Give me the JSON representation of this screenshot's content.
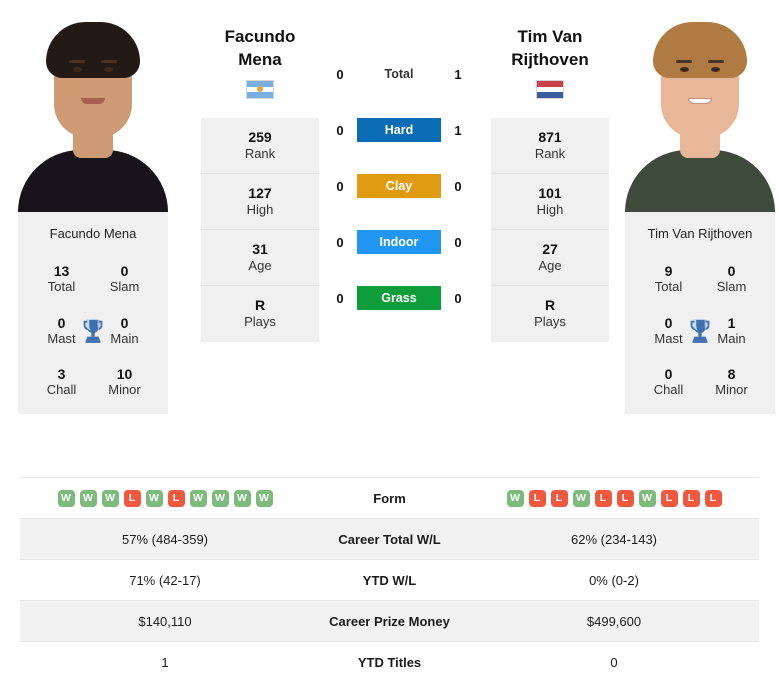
{
  "players": {
    "left": {
      "name_lines": [
        "Facundo",
        "Mena"
      ],
      "full_name": "Facundo Mena",
      "country": "Argentina",
      "flag": "argentina-flag",
      "photo_alt": "facundo-mena-photo",
      "stats": [
        {
          "value": "259",
          "label": "Rank"
        },
        {
          "value": "127",
          "label": "High"
        },
        {
          "value": "31",
          "label": "Age"
        },
        {
          "value": "R",
          "label": "Plays"
        }
      ],
      "titles": [
        {
          "value": "13",
          "label": "Total"
        },
        {
          "value": "0",
          "label": "Slam"
        },
        {
          "value": "0",
          "label": "Mast"
        },
        {
          "value": "0",
          "label": "Main"
        },
        {
          "value": "3",
          "label": "Chall"
        },
        {
          "value": "10",
          "label": "Minor"
        }
      ],
      "form": [
        "W",
        "W",
        "W",
        "L",
        "W",
        "L",
        "W",
        "W",
        "W",
        "W"
      ],
      "career_total_wl": "57% (484-359)",
      "ytd_wl": "71% (42-17)",
      "career_prize_money": "$140,110",
      "ytd_titles": "1"
    },
    "right": {
      "name_lines": [
        "Tim Van",
        "Rijthoven"
      ],
      "full_name": "Tim Van Rijthoven",
      "country": "Netherlands",
      "flag": "netherlands-flag",
      "photo_alt": "tim-van-rijthoven-photo",
      "stats": [
        {
          "value": "871",
          "label": "Rank"
        },
        {
          "value": "101",
          "label": "High"
        },
        {
          "value": "27",
          "label": "Age"
        },
        {
          "value": "R",
          "label": "Plays"
        }
      ],
      "titles": [
        {
          "value": "9",
          "label": "Total"
        },
        {
          "value": "0",
          "label": "Slam"
        },
        {
          "value": "0",
          "label": "Mast"
        },
        {
          "value": "1",
          "label": "Main"
        },
        {
          "value": "0",
          "label": "Chall"
        },
        {
          "value": "8",
          "label": "Minor"
        }
      ],
      "form": [
        "W",
        "L",
        "L",
        "W",
        "L",
        "L",
        "W",
        "L",
        "L",
        "L"
      ],
      "career_total_wl": "62% (234-143)",
      "ytd_wl": "0% (0-2)",
      "career_prize_money": "$499,600",
      "ytd_titles": "0"
    }
  },
  "head_to_head": [
    {
      "label": "Total",
      "left": "0",
      "right": "1",
      "color": ""
    },
    {
      "label": "Hard",
      "left": "0",
      "right": "1",
      "color": "#0a6cb5"
    },
    {
      "label": "Clay",
      "left": "0",
      "right": "0",
      "color": "#e09b10"
    },
    {
      "label": "Indoor",
      "left": "0",
      "right": "0",
      "color": "#2196f3"
    },
    {
      "label": "Grass",
      "left": "0",
      "right": "0",
      "color": "#0d9d3a"
    }
  ],
  "table_rows": [
    {
      "label": "Form",
      "key": "form",
      "type": "form"
    },
    {
      "label": "Career Total W/L",
      "key": "career_total_wl",
      "type": "text"
    },
    {
      "label": "YTD W/L",
      "key": "ytd_wl",
      "type": "text"
    },
    {
      "label": "Career Prize Money",
      "key": "career_prize_money",
      "type": "text"
    },
    {
      "label": "YTD Titles",
      "key": "ytd_titles",
      "type": "text"
    }
  ],
  "icons": {
    "trophy": "trophy-icon"
  },
  "colors": {
    "hard": "#0a6cb5",
    "clay": "#e09b10",
    "indoor": "#2196f3",
    "grass": "#0d9d3a",
    "win": "#7cbb7c",
    "loss": "#f2583e",
    "panel": "#f0f0f0",
    "trophy": "#3e6fb0"
  }
}
